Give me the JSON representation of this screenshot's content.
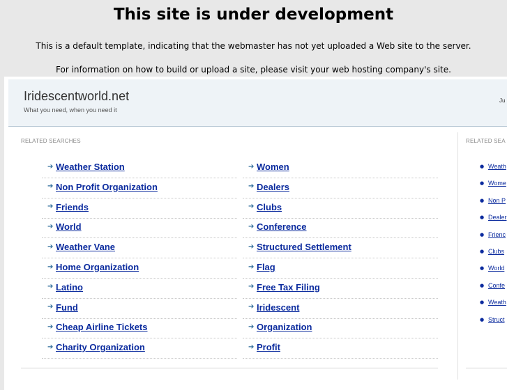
{
  "notice": {
    "title": "This site is under development",
    "line1": "This is a default template, indicating that the webmaster has not yet uploaded a Web site to the server.",
    "line2": "For information on how to build or upload a site, please visit your web hosting company's site."
  },
  "header": {
    "site_name": "Iridescentworld.net",
    "tagline": "What you need, when you need it",
    "right_text": "Ju"
  },
  "main": {
    "section_label": "RELATED SEARCHES",
    "left_links": [
      "Weather Station",
      "Non Profit Organization",
      "Friends",
      "World",
      "Weather Vane",
      "Home Organization",
      "Latino",
      "Fund",
      "Cheap Airline Tickets",
      "Charity Organization"
    ],
    "right_links": [
      "Women",
      "Dealers",
      "Clubs",
      "Conference",
      "Structured Settlement",
      "Flag",
      "Free Tax Filing",
      "Iridescent",
      "Organization",
      "Profit"
    ]
  },
  "sidebar": {
    "section_label": "RELATED SEA",
    "links": [
      "Weath",
      "Wome",
      "Non P",
      "Dealer",
      "Frienc",
      "Clubs",
      "World",
      "Confe",
      "Weath",
      "Struct"
    ]
  },
  "colors": {
    "link": "#0b2b9e",
    "arrow": "#2f6c9b",
    "header_bg": "#eef3f7",
    "page_bg": "#e8e8e8"
  },
  "icons": {
    "arrow": "arrow-right-icon",
    "bullet": "bullet-icon"
  }
}
